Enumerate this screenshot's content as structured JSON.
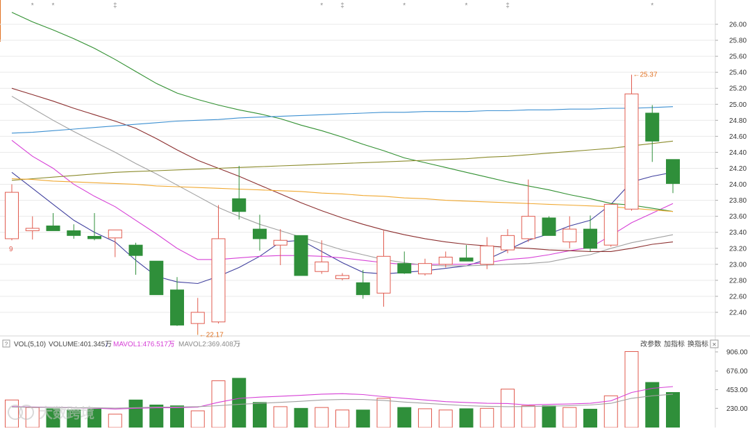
{
  "chart_data": {
    "type": "candlestick",
    "price_axis": {
      "ticks": [
        "26.00",
        "25.80",
        "25.60",
        "25.40",
        "25.20",
        "25.00",
        "24.80",
        "24.60",
        "24.40",
        "24.20",
        "24.00",
        "23.80",
        "23.60",
        "23.40",
        "23.20",
        "23.00",
        "22.80",
        "22.60",
        "22.40"
      ]
    },
    "candles": [
      {
        "o": 23.32,
        "h": 24.0,
        "l": 23.3,
        "c": 23.9
      },
      {
        "o": 23.42,
        "h": 23.6,
        "l": 23.31,
        "c": 23.45
      },
      {
        "o": 23.48,
        "h": 23.64,
        "l": 23.42,
        "c": 23.42
      },
      {
        "o": 23.42,
        "h": 23.5,
        "l": 23.32,
        "c": 23.36
      },
      {
        "o": 23.35,
        "h": 23.64,
        "l": 23.3,
        "c": 23.32
      },
      {
        "o": 23.33,
        "h": 23.43,
        "l": 23.09,
        "c": 23.43
      },
      {
        "o": 23.24,
        "h": 23.27,
        "l": 22.87,
        "c": 23.11
      },
      {
        "o": 23.04,
        "h": 23.04,
        "l": 22.62,
        "c": 22.62
      },
      {
        "o": 22.68,
        "h": 22.84,
        "l": 22.23,
        "c": 22.24
      },
      {
        "o": 22.26,
        "h": 22.58,
        "l": 22.17,
        "c": 22.4
      },
      {
        "o": 22.28,
        "h": 23.74,
        "l": 22.26,
        "c": 23.32
      },
      {
        "o": 23.82,
        "h": 24.23,
        "l": 23.56,
        "c": 23.66
      },
      {
        "o": 23.44,
        "h": 23.62,
        "l": 23.17,
        "c": 23.32
      },
      {
        "o": 23.24,
        "h": 23.44,
        "l": 22.99,
        "c": 23.3
      },
      {
        "o": 23.36,
        "h": 23.36,
        "l": 22.86,
        "c": 22.86
      },
      {
        "o": 22.91,
        "h": 23.3,
        "l": 22.88,
        "c": 23.03
      },
      {
        "o": 22.82,
        "h": 22.89,
        "l": 22.8,
        "c": 22.86
      },
      {
        "o": 22.77,
        "h": 22.93,
        "l": 22.57,
        "c": 22.62
      },
      {
        "o": 22.64,
        "h": 23.42,
        "l": 22.47,
        "c": 23.1
      },
      {
        "o": 23.01,
        "h": 23.16,
        "l": 22.88,
        "c": 22.89
      },
      {
        "o": 22.88,
        "h": 23.07,
        "l": 22.86,
        "c": 23.01
      },
      {
        "o": 23.0,
        "h": 23.16,
        "l": 22.96,
        "c": 23.09
      },
      {
        "o": 23.08,
        "h": 23.24,
        "l": 23.04,
        "c": 23.04
      },
      {
        "o": 23.0,
        "h": 23.34,
        "l": 22.94,
        "c": 23.23
      },
      {
        "o": 23.18,
        "h": 23.44,
        "l": 23.14,
        "c": 23.36
      },
      {
        "o": 23.32,
        "h": 24.06,
        "l": 23.28,
        "c": 23.6
      },
      {
        "o": 23.58,
        "h": 23.6,
        "l": 23.36,
        "c": 23.36
      },
      {
        "o": 23.28,
        "h": 23.6,
        "l": 23.2,
        "c": 23.44
      },
      {
        "o": 23.44,
        "h": 23.61,
        "l": 23.16,
        "c": 23.2
      },
      {
        "o": 23.24,
        "h": 23.75,
        "l": 23.22,
        "c": 23.75
      },
      {
        "o": 23.69,
        "h": 25.37,
        "l": 23.67,
        "c": 25.13
      },
      {
        "o": 24.89,
        "h": 24.99,
        "l": 24.28,
        "c": 24.54
      },
      {
        "o": 24.31,
        "h": 24.31,
        "l": 23.89,
        "c": 24.01
      }
    ],
    "ma_lines": [
      {
        "color": "#3f3f9e",
        "values": [
          24.15,
          23.95,
          23.75,
          23.55,
          23.4,
          23.28,
          23.05,
          22.85,
          22.78,
          22.76,
          22.85,
          22.96,
          23.1,
          23.28,
          23.3,
          23.16,
          23.02,
          22.9,
          22.88,
          22.9,
          22.92,
          22.95,
          22.98,
          23.06,
          23.18,
          23.3,
          23.38,
          23.48,
          23.55,
          23.75,
          24.03,
          24.1,
          24.15
        ]
      },
      {
        "color": "#d63fd6",
        "values": [
          24.55,
          24.35,
          24.2,
          24.0,
          23.85,
          23.72,
          23.55,
          23.38,
          23.2,
          23.06,
          23.06,
          23.08,
          23.1,
          23.11,
          23.11,
          23.1,
          23.08,
          23.05,
          23.02,
          23.0,
          23.0,
          23.0,
          23.0,
          23.02,
          23.06,
          23.08,
          23.12,
          23.17,
          23.21,
          23.36,
          23.52,
          23.64,
          23.76
        ]
      },
      {
        "color": "#a0a0a0",
        "values": [
          25.1,
          24.95,
          24.8,
          24.66,
          24.53,
          24.4,
          24.26,
          24.13,
          23.99,
          23.85,
          23.71,
          23.6,
          23.5,
          23.42,
          23.34,
          23.26,
          23.18,
          23.12,
          23.06,
          23.02,
          22.99,
          22.98,
          22.98,
          22.99,
          23.0,
          23.01,
          23.03,
          23.08,
          23.12,
          23.2,
          23.27,
          23.32,
          23.37
        ]
      },
      {
        "color": "#8b2d2d",
        "values": [
          25.2,
          25.12,
          25.04,
          24.95,
          24.87,
          24.79,
          24.7,
          24.57,
          24.43,
          24.3,
          24.2,
          24.1,
          23.99,
          23.88,
          23.77,
          23.67,
          23.58,
          23.5,
          23.43,
          23.37,
          23.32,
          23.28,
          23.25,
          23.23,
          23.21,
          23.2,
          23.18,
          23.17,
          23.16,
          23.16,
          23.2,
          23.25,
          23.28
        ]
      },
      {
        "color": "#2f8f2f",
        "values": [
          26.15,
          26.03,
          25.93,
          25.82,
          25.7,
          25.56,
          25.41,
          25.26,
          25.14,
          25.06,
          24.99,
          24.93,
          24.88,
          24.82,
          24.74,
          24.67,
          24.59,
          24.5,
          24.42,
          24.33,
          24.27,
          24.21,
          24.15,
          24.09,
          24.03,
          23.98,
          23.93,
          23.87,
          23.82,
          23.76,
          23.74,
          23.7,
          23.66
        ]
      },
      {
        "color": "#3b8fd1",
        "values": [
          24.64,
          24.65,
          24.67,
          24.69,
          24.71,
          24.73,
          24.75,
          24.77,
          24.79,
          24.8,
          24.81,
          24.83,
          24.84,
          24.85,
          24.86,
          24.87,
          24.88,
          24.89,
          24.9,
          24.9,
          24.91,
          24.91,
          24.91,
          24.92,
          24.92,
          24.93,
          24.93,
          24.94,
          24.94,
          24.95,
          24.95,
          24.96,
          24.97
        ]
      },
      {
        "color": "#8a8a2a",
        "values": [
          24.05,
          24.07,
          24.09,
          24.11,
          24.13,
          24.15,
          24.16,
          24.17,
          24.18,
          24.19,
          24.2,
          24.21,
          24.22,
          24.23,
          24.24,
          24.25,
          24.26,
          24.27,
          24.28,
          24.29,
          24.3,
          24.31,
          24.32,
          24.34,
          24.35,
          24.37,
          24.39,
          24.41,
          24.43,
          24.45,
          24.48,
          24.51,
          24.54
        ]
      },
      {
        "color": "#f0a830",
        "values": [
          24.07,
          24.06,
          24.04,
          24.03,
          24.02,
          24.01,
          24.0,
          23.98,
          23.97,
          23.96,
          23.95,
          23.94,
          23.93,
          23.92,
          23.91,
          23.89,
          23.88,
          23.86,
          23.85,
          23.83,
          23.82,
          23.8,
          23.79,
          23.78,
          23.77,
          23.76,
          23.75,
          23.74,
          23.73,
          23.72,
          23.7,
          23.68,
          23.66
        ]
      }
    ],
    "annotations": {
      "start_label": "9",
      "high_label": "25.37",
      "low_label": "22.17",
      "top_markers": [
        "*",
        "*",
        "‡",
        "*",
        "‡",
        "*",
        "*",
        "‡",
        "*"
      ]
    },
    "volume": {
      "axis_ticks": [
        "906.00",
        "676.00",
        "453.00",
        "230.00"
      ],
      "values": [
        330,
        240,
        225,
        210,
        220,
        160,
        330,
        270,
        260,
        200,
        560,
        590,
        300,
        250,
        230,
        240,
        210,
        210,
        350,
        240,
        225,
        210,
        225,
        230,
        460,
        260,
        260,
        240,
        220,
        380,
        910,
        540,
        420
      ],
      "mavol1": [
        250,
        246,
        242,
        238,
        232,
        222,
        230,
        236,
        238,
        244,
        302,
        349,
        364,
        375,
        386,
        400,
        406,
        395,
        370,
        350,
        330,
        310,
        300,
        290,
        288,
        270,
        278,
        282,
        290,
        320,
        420,
        470,
        490
      ],
      "mavol2": [
        245,
        243,
        240,
        238,
        236,
        232,
        238,
        244,
        246,
        250,
        262,
        278,
        290,
        302,
        314,
        330,
        336,
        336,
        325,
        305,
        290,
        276,
        262,
        254,
        250,
        252,
        256,
        262,
        270,
        290,
        350,
        380,
        400
      ]
    }
  },
  "vol_header": {
    "help_glyph": "?",
    "indicator": "VOL(5,10)",
    "volume_text": "VOLUME:401.345万",
    "volume_arrow": "↓",
    "mavol1_text": "MAVOL1:476.517万",
    "mavol1_arrow": "↑",
    "mavol2_text": "MAVOL2:369.408万",
    "mavol2_arrow": "↑"
  },
  "vol_toolbar": {
    "modify_params": "改参数",
    "add_indicator": "加指标",
    "switch_indicator": "换指标",
    "close_glyph": "×"
  },
  "watermark": {
    "text": "大数跨境"
  },
  "colors": {
    "up": "#e05a4e",
    "down": "#2f8f3a",
    "vol_ma1": "#d63fd6",
    "vol_ma2": "#a0a0a0",
    "annot": "#e07020",
    "grid": "#e9e9e9"
  }
}
